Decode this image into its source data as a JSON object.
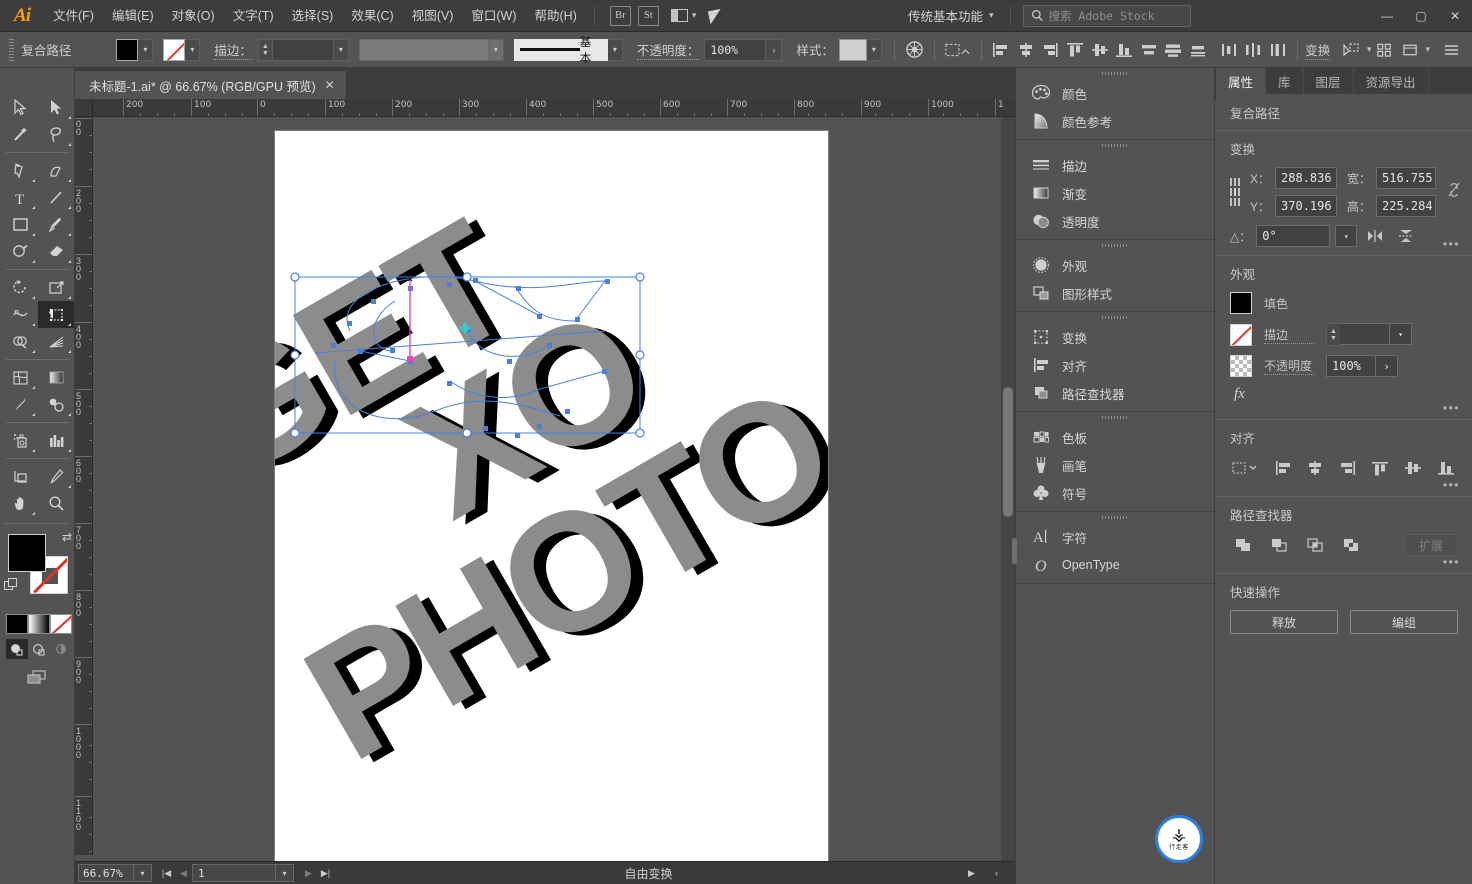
{
  "app": {
    "name": "Adobe Illustrator",
    "logo_text": "Ai"
  },
  "menubar": {
    "items": [
      {
        "label": "文件(F)",
        "name": "menu-file"
      },
      {
        "label": "编辑(E)",
        "name": "menu-edit"
      },
      {
        "label": "对象(O)",
        "name": "menu-object"
      },
      {
        "label": "文字(T)",
        "name": "menu-type"
      },
      {
        "label": "选择(S)",
        "name": "menu-select"
      },
      {
        "label": "效果(C)",
        "name": "menu-effect"
      },
      {
        "label": "视图(V)",
        "name": "menu-view"
      },
      {
        "label": "窗口(W)",
        "name": "menu-window"
      },
      {
        "label": "帮助(H)",
        "name": "menu-help"
      }
    ],
    "bridge_button": "Br",
    "stock_button": "St",
    "workspace": "传统基本功能",
    "search_placeholder": "搜索 Adobe Stock",
    "window_controls": {
      "minimize": "—",
      "maximize": "▢",
      "close": "✕"
    }
  },
  "controlbar": {
    "object_type": "复合路径",
    "fill_label": "填色",
    "stroke_label": "描边：",
    "stroke_weight": "",
    "stroke_profile_label": "基本",
    "opacity_label": "不透明度：",
    "opacity_value": "100%",
    "style_label": "样式：",
    "transform_label": "变换",
    "align_icons": [
      "align-left",
      "align-center-h",
      "align-right",
      "align-top",
      "align-middle-v",
      "align-bottom",
      "distribute-top",
      "distribute-middle",
      "distribute-bottom",
      "distribute-left",
      "distribute-center",
      "distribute-right"
    ],
    "arrange_icon": "arrange-icon",
    "doc_setup_icon": "document-setup-icon",
    "recolor_icon": "recolor-artwork-icon"
  },
  "document_tab": {
    "title": "未标题-1.ai* @ 66.67% (RGB/GPU 预览)",
    "close": "✕"
  },
  "toolbar": {
    "tools": [
      {
        "name": "selection-tool",
        "glyph": "selection"
      },
      {
        "name": "direct-selection-tool",
        "glyph": "direct-selection"
      },
      {
        "name": "magic-wand-tool",
        "glyph": "magic-wand"
      },
      {
        "name": "lasso-tool",
        "glyph": "lasso"
      },
      {
        "name": "pen-tool",
        "glyph": "pen"
      },
      {
        "name": "curvature-tool",
        "glyph": "curvature"
      },
      {
        "name": "type-tool",
        "glyph": "type"
      },
      {
        "name": "line-segment-tool",
        "glyph": "line"
      },
      {
        "name": "rectangle-tool",
        "glyph": "rectangle"
      },
      {
        "name": "paintbrush-tool",
        "glyph": "paintbrush"
      },
      {
        "name": "shaper-tool",
        "glyph": "shaper"
      },
      {
        "name": "eraser-tool",
        "glyph": "eraser"
      },
      {
        "name": "rotate-tool",
        "glyph": "rotate"
      },
      {
        "name": "scale-tool",
        "glyph": "scale"
      },
      {
        "name": "width-tool",
        "glyph": "width"
      },
      {
        "name": "free-transform-tool",
        "glyph": "free-transform",
        "active": true
      },
      {
        "name": "shape-builder-tool",
        "glyph": "shape-builder"
      },
      {
        "name": "perspective-grid-tool",
        "glyph": "perspective-grid"
      },
      {
        "name": "mesh-tool",
        "glyph": "mesh"
      },
      {
        "name": "gradient-tool",
        "glyph": "gradient"
      },
      {
        "name": "eyedropper-tool",
        "glyph": "eyedropper"
      },
      {
        "name": "blend-tool",
        "glyph": "blend"
      },
      {
        "name": "symbol-sprayer-tool",
        "glyph": "symbol-sprayer"
      },
      {
        "name": "column-graph-tool",
        "glyph": "column-graph"
      },
      {
        "name": "artboard-tool",
        "glyph": "artboard"
      },
      {
        "name": "slice-tool",
        "glyph": "slice"
      },
      {
        "name": "hand-tool",
        "glyph": "hand"
      },
      {
        "name": "zoom-tool",
        "glyph": "zoom"
      }
    ],
    "fill_color": "#000000",
    "stroke_color": "none",
    "draw_modes": [
      "draw-normal",
      "draw-behind",
      "draw-inside"
    ],
    "screen_mode": "change-screen-mode"
  },
  "float_panel": {
    "tools": [
      {
        "name": "free-transform-constrain",
        "glyph": "constrain"
      },
      {
        "name": "free-transform-mode",
        "glyph": "free-transform-hand",
        "active": true
      },
      {
        "name": "perspective-distort",
        "glyph": "perspective-distort"
      },
      {
        "name": "free-distort",
        "glyph": "free-distort"
      }
    ]
  },
  "dock": {
    "groups": [
      {
        "items": [
          {
            "label": "颜色",
            "name": "panel-color",
            "icon": "color-palette-icon"
          },
          {
            "label": "颜色参考",
            "name": "panel-color-guide",
            "icon": "color-guide-icon"
          }
        ]
      },
      {
        "items": [
          {
            "label": "描边",
            "name": "panel-stroke",
            "icon": "stroke-icon"
          },
          {
            "label": "渐变",
            "name": "panel-gradient",
            "icon": "gradient-icon"
          },
          {
            "label": "透明度",
            "name": "panel-transparency",
            "icon": "transparency-icon"
          }
        ]
      },
      {
        "items": [
          {
            "label": "外观",
            "name": "panel-appearance",
            "icon": "appearance-icon"
          },
          {
            "label": "图形样式",
            "name": "panel-graphic-styles",
            "icon": "graphic-styles-icon"
          }
        ]
      },
      {
        "items": [
          {
            "label": "变换",
            "name": "panel-transform",
            "icon": "transform-icon"
          },
          {
            "label": "对齐",
            "name": "panel-align",
            "icon": "align-icon"
          },
          {
            "label": "路径查找器",
            "name": "panel-pathfinder",
            "icon": "pathfinder-icon"
          }
        ]
      },
      {
        "items": [
          {
            "label": "色板",
            "name": "panel-swatches",
            "icon": "swatches-icon"
          },
          {
            "label": "画笔",
            "name": "panel-brushes",
            "icon": "brushes-icon"
          },
          {
            "label": "符号",
            "name": "panel-symbols",
            "icon": "symbols-icon"
          }
        ]
      },
      {
        "items": [
          {
            "label": "字符",
            "name": "panel-character",
            "icon": "character-icon"
          },
          {
            "label": "OpenType",
            "name": "panel-opentype",
            "icon": "opentype-icon"
          }
        ]
      }
    ]
  },
  "properties": {
    "tabs": [
      {
        "label": "属性",
        "name": "tab-properties",
        "active": true
      },
      {
        "label": "库",
        "name": "tab-libraries",
        "active": false
      },
      {
        "label": "图层",
        "name": "tab-layers",
        "active": false
      },
      {
        "label": "资源导出",
        "name": "tab-asset-export",
        "active": false
      }
    ],
    "selection_type": "复合路径",
    "transform": {
      "heading": "变换",
      "x_label": "X：",
      "x_value": "288.836",
      "y_label": "Y：",
      "y_value": "370.196",
      "w_label": "宽：",
      "w_value": "516.755",
      "h_label": "高：",
      "h_value": "225.284",
      "angle_label": "△：",
      "angle_value": "0°",
      "link_icon": "constrain-proportions-icon",
      "flip_h_icon": "flip-horizontal-icon",
      "flip_v_icon": "flip-vertical-icon",
      "more_options": "•••"
    },
    "appearance": {
      "heading": "外观",
      "fill_label": "填色",
      "fill_color": "#000000",
      "stroke_label": "描边",
      "stroke_value": "",
      "opacity_label": "不透明度",
      "opacity_value": "100%",
      "fx_label": "fx",
      "more_options": "•••"
    },
    "align": {
      "heading": "对齐",
      "buttons": [
        "align-to-selection",
        "align-left",
        "align-center-h",
        "align-right",
        "align-top",
        "align-middle-v",
        "align-bottom"
      ],
      "more_options": "•••"
    },
    "pathfinder": {
      "heading": "路径查找器",
      "buttons": [
        "unite",
        "minus-front",
        "intersect",
        "exclude"
      ],
      "expand_label": "扩展",
      "more_options": "•••"
    },
    "quick_actions": {
      "heading": "快速操作",
      "buttons": [
        {
          "label": "释放",
          "name": "release-button"
        },
        {
          "label": "编组",
          "name": "group-button"
        }
      ]
    }
  },
  "statusbar": {
    "zoom": "66.67%",
    "page": "1",
    "status_text": "自由变换",
    "first_icon": "first-page-icon",
    "prev_icon": "previous-page-icon",
    "next_icon": "next-page-icon",
    "last_icon": "last-page-icon"
  },
  "rulers": {
    "horizontal_labels": [
      "200",
      "100",
      "0",
      "100",
      "200",
      "300",
      "400",
      "500",
      "600",
      "700",
      "800",
      "900",
      "1000"
    ],
    "vertical_labels": [
      "0",
      "200",
      "300",
      "400",
      "500",
      "600",
      "700",
      "800",
      "900",
      "1000",
      "1100"
    ],
    "unit": "px"
  },
  "artwork": {
    "description": "Rotated bold display type composition reading GET XO PHOTO with gray fill and black offset shadow",
    "words": [
      "GET",
      "XO",
      "PHOTO"
    ],
    "fill_color": "#8c8c8c",
    "shadow_color": "#000000",
    "selection_color": "#4a7fe0"
  },
  "watermark": {
    "deer": "🦌",
    "text": "行走客"
  }
}
